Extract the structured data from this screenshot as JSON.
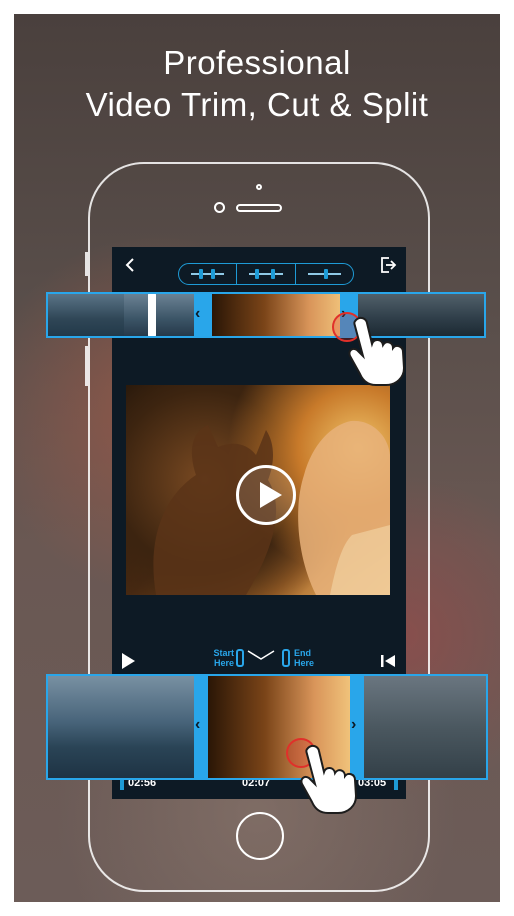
{
  "headline": {
    "line1": "Professional",
    "line2": "Video Trim, Cut & Split"
  },
  "controls": {
    "start_marker": "Start\nHere",
    "end_marker": "End\nHere"
  },
  "timeline": {
    "start_time": "02:56",
    "current_time": "02:07",
    "end_time": "03:05"
  },
  "colors": {
    "accent": "#29a6ea",
    "screen_bg": "#0d1a25",
    "tap_indicator": "#e0302a"
  },
  "icons": [
    "back-icon",
    "export-icon",
    "trim-mode-icon",
    "cut-mode-icon",
    "split-mode-icon",
    "play-icon",
    "skip-to-start-icon",
    "hand-pointer-icon"
  ]
}
